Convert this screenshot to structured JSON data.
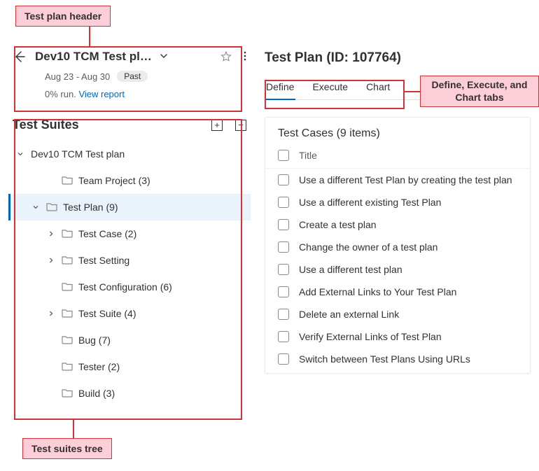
{
  "annotations": {
    "header": "Test plan header",
    "tree": "Test suites tree",
    "tabs": "Define, Execute, and Chart tabs"
  },
  "plan_header": {
    "title": "Dev10 TCM Test pl…",
    "date_range": "Aug 23 - Aug 30",
    "past_badge": "Past",
    "progress_text": "0% run.",
    "view_report": "View report"
  },
  "suites": {
    "title": "Test Suites",
    "expand_btn": "+",
    "collapse_btn": "−",
    "tree": [
      {
        "label": "Dev10 TCM Test plan",
        "depth": 0,
        "caret": "down",
        "icon": false,
        "selected": false
      },
      {
        "label": "Team Project (3)",
        "depth": 2,
        "caret": "none",
        "icon": true,
        "selected": false
      },
      {
        "label": "Test Plan (9)",
        "depth": 1,
        "caret": "down",
        "icon": true,
        "selected": true
      },
      {
        "label": "Test Case (2)",
        "depth": 2,
        "caret": "right",
        "icon": true,
        "selected": false
      },
      {
        "label": "Test Setting",
        "depth": 2,
        "caret": "right",
        "icon": true,
        "selected": false
      },
      {
        "label": "Test Configuration (6)",
        "depth": 2,
        "caret": "none",
        "icon": true,
        "selected": false
      },
      {
        "label": "Test Suite (4)",
        "depth": 2,
        "caret": "right",
        "icon": true,
        "selected": false
      },
      {
        "label": "Bug (7)",
        "depth": 2,
        "caret": "none",
        "icon": true,
        "selected": false
      },
      {
        "label": "Tester (2)",
        "depth": 2,
        "caret": "none",
        "icon": true,
        "selected": false
      },
      {
        "label": "Build (3)",
        "depth": 2,
        "caret": "none",
        "icon": true,
        "selected": false
      }
    ]
  },
  "right": {
    "title": "Test Plan (ID: 107764)",
    "tabs": [
      {
        "label": "Define",
        "active": true
      },
      {
        "label": "Execute",
        "active": false
      },
      {
        "label": "Chart",
        "active": false
      }
    ],
    "cases_title": "Test Cases (9 items)",
    "column_header": "Title",
    "cases": [
      "Use a different Test Plan by creating the test plan",
      "Use a different existing Test Plan",
      "Create a test plan",
      "Change the owner of a test plan",
      "Use a different test plan",
      "Add External Links to Your Test Plan",
      "Delete an external Link",
      "Verify External Links of Test Plan",
      "Switch between Test Plans Using URLs"
    ]
  }
}
